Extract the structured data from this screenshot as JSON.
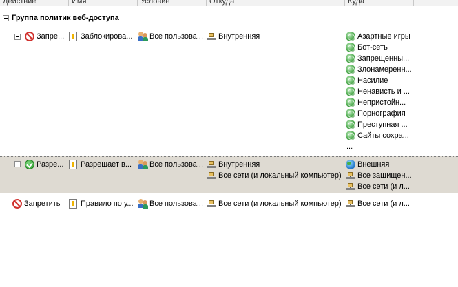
{
  "columns": [
    "Действие",
    "Имя",
    "Условие",
    "Откуда",
    "Куда"
  ],
  "group": {
    "title": "Группа политик веб-доступа"
  },
  "rules": [
    {
      "action": "Запре...",
      "action_icon": "deny-icon",
      "name": "Заблокирова...",
      "condition": "Все пользова...",
      "from": [
        "Внутренняя"
      ],
      "to": [
        "Азартные игры",
        "Бот-сеть",
        "Запрещенны...",
        "Злонамеренн...",
        "Насилие",
        "Ненависть и ...",
        "Непристойн...",
        "Порнография",
        "Преступная ...",
        "Сайты сохра..."
      ],
      "to_more": "..."
    },
    {
      "action": "Разре...",
      "action_icon": "allow-icon",
      "name": "Разрешает в...",
      "condition": "Все пользова...",
      "from": [
        "Внутренняя",
        "Все сети (и локальный компьютер)"
      ],
      "to": [
        "Внешняя",
        "Все защищен...",
        "Все сети (и л..."
      ]
    },
    {
      "action": "Запретить",
      "action_icon": "deny-icon",
      "name": "Правило по у...",
      "condition": "Все пользова...",
      "from": [
        "Все сети (и локальный компьютер)"
      ],
      "to": [
        "Все сети (и л..."
      ]
    }
  ]
}
